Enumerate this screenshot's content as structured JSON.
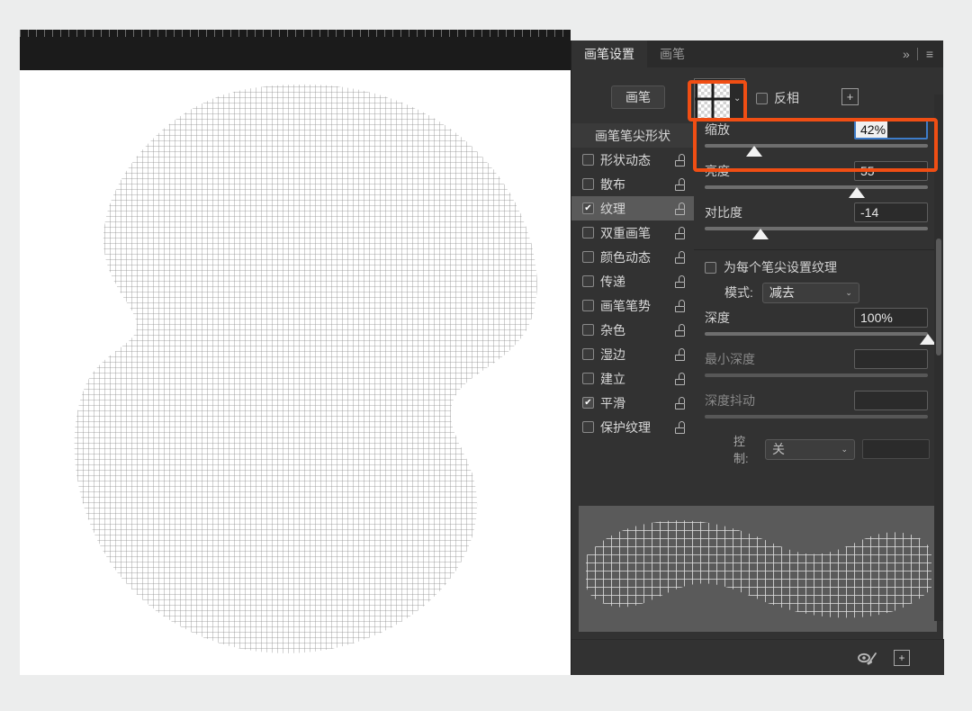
{
  "app": {
    "panel_title": "画笔设置"
  },
  "panel": {
    "tabs": [
      {
        "label": "画笔设置",
        "active": true
      },
      {
        "label": "画笔",
        "active": false
      }
    ],
    "header_icons": {
      "collapse": "»",
      "menu": "≡"
    },
    "brush_button_label": "画笔",
    "invert_label": "反相",
    "add_texture_icon": "+",
    "texture_caret": "⌄"
  },
  "options": {
    "title": "画笔笔尖形状",
    "items": [
      {
        "label": "形状动态",
        "checked": false,
        "selected": false
      },
      {
        "label": "散布",
        "checked": false,
        "selected": false
      },
      {
        "label": "纹理",
        "checked": true,
        "selected": true
      },
      {
        "label": "双重画笔",
        "checked": false,
        "selected": false
      },
      {
        "label": "颜色动态",
        "checked": false,
        "selected": false
      },
      {
        "label": "传递",
        "checked": false,
        "selected": false
      },
      {
        "label": "画笔笔势",
        "checked": false,
        "selected": false
      },
      {
        "label": "杂色",
        "checked": false,
        "selected": false
      },
      {
        "label": "湿边",
        "checked": false,
        "selected": false
      },
      {
        "label": "建立",
        "checked": false,
        "selected": false
      },
      {
        "label": "平滑",
        "checked": true,
        "selected": false
      },
      {
        "label": "保护纹理",
        "checked": false,
        "selected": false
      }
    ],
    "check_glyph": "✔"
  },
  "controls": {
    "scale": {
      "label": "缩放",
      "value": "42%",
      "slider_pct": 22,
      "focused": true
    },
    "brightness": {
      "label": "亮度",
      "value": "55",
      "slider_pct": 68
    },
    "contrast": {
      "label": "对比度",
      "value": "-14",
      "slider_pct": 25
    },
    "per_tip_texture": {
      "label": "为每个笔尖设置纹理",
      "checked": false
    },
    "mode": {
      "label": "模式:",
      "value": "减去",
      "caret": "⌄"
    },
    "depth": {
      "label": "深度",
      "value": "100%",
      "slider_pct": 100
    },
    "min_depth": {
      "label": "最小深度",
      "value": "",
      "slider_pct": 0,
      "disabled": true
    },
    "depth_jitter": {
      "label": "深度抖动",
      "value": "",
      "slider_pct": 0,
      "disabled": true
    },
    "control": {
      "label": "控制:",
      "value": "关",
      "caret": "⌄"
    }
  },
  "footer": {
    "toggle_brush_icon": "brush-toggle-icon",
    "new_brush_icon": "+"
  },
  "annotations": {
    "color": "#f04e14",
    "boxes": [
      {
        "name": "texture-swatch-highlight"
      },
      {
        "name": "scale-row-highlight"
      }
    ]
  },
  "canvas": {
    "artwork_description": "grid-textured blob shape"
  }
}
